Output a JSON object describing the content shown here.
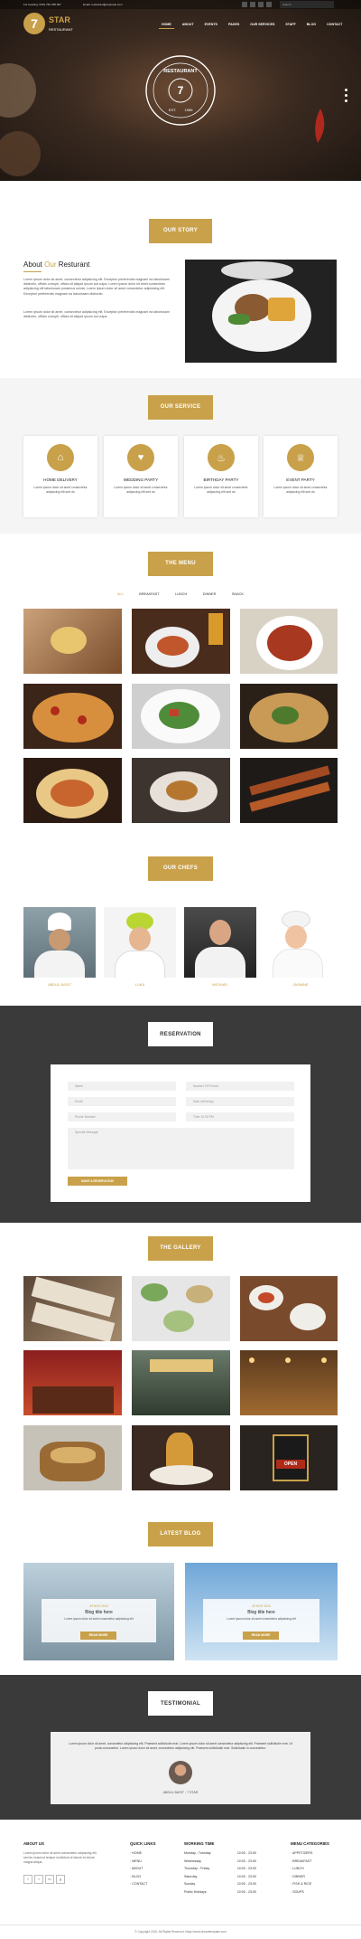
{
  "topbar": {
    "contact": "For booking: 0301 765 788 007",
    "email": "Email: restaurant@example.com"
  },
  "brand": {
    "number": "7",
    "name": "STAR",
    "sub": "RESTAURANT"
  },
  "nav": [
    {
      "label": "HOME"
    },
    {
      "label": "ABOUT"
    },
    {
      "label": "EVENTS"
    },
    {
      "label": "PAGES"
    },
    {
      "label": "OUR SERVICES"
    },
    {
      "label": "STAFF"
    },
    {
      "label": "BLOG"
    },
    {
      "label": "CONTACT"
    }
  ],
  "hero": {
    "logo_top": "RESTAURANT",
    "logo_num": "7",
    "logo_est": "EST.",
    "logo_year": "1986"
  },
  "story": {
    "title": "OUR STORY",
    "heading_pre": "About ",
    "heading_accent": "Our",
    "heading_post": " Resturant",
    "p1": "Lorem ipsum dolor sit amet, consectetur adipisicing elit. Excepturi perferendis magnam ea laboriosam distinctio, officiis corrupti, officia sit aliquid ipsum aut culpa. Lorem ipsum dolor sit amet consectetur adipisicing elit laboriosam possimus soluta. Lorem ipsum dolor sit amet consectetur adipisicing elit. Excepturi perferendis magnam ea laboriosam distinctio.",
    "p2": "Lorem ipsum dolor sit amet, consectetur adipisicing elit. Excepturi perferendis magnam ea laboriosam distinctio, officiis corrupti, officia sit aliquid ipsum aut culpa."
  },
  "service": {
    "title": "OUR SERVICE",
    "cards": [
      {
        "icon": "home-icon",
        "glyph": "⌂",
        "title": "HOME DELIVERY",
        "desc": "Lorem ipsum dolor sit amet consectetur adipiscing elit sed do"
      },
      {
        "icon": "heart-icon",
        "glyph": "♥",
        "title": "WEDDING PARTY",
        "desc": "Lorem ipsum dolor sit amet consectetur adipiscing elit sed do"
      },
      {
        "icon": "cake-icon",
        "glyph": "♨",
        "title": "BIRTHDAY PARTY",
        "desc": "Lorem ipsum dolor sit amet consectetur adipiscing elit sed do"
      },
      {
        "icon": "cup-icon",
        "glyph": "♕",
        "title": "EVENT PARTY",
        "desc": "Lorem ipsum dolor sit amet consectetur adipiscing elit sed do"
      }
    ]
  },
  "menu": {
    "title": "THE MENU",
    "filters": [
      "ALL",
      "BREAKFAST",
      "LUNCH",
      "DINNER",
      "SNACK"
    ]
  },
  "chefs": {
    "title": "OUR CHEFS",
    "names": [
      "ABDUL BASIT",
      "LUKA",
      "MICHAEL",
      "JASMINE"
    ]
  },
  "reservation": {
    "title": "RESERVATION",
    "fields": {
      "name": "Name",
      "number": "Number Of Person",
      "email": "Email",
      "date": "Date dd/mm/yy",
      "phone": "Phone Number",
      "time": "Time 10:00 PM",
      "message": "Special Message"
    },
    "button": "MAKE A RESERVATION"
  },
  "gallery": {
    "title": "THE GALLERY"
  },
  "blog": {
    "title": "LATEST BLOG",
    "posts": [
      {
        "date": "29 NOV 2016",
        "title": "Blog title here",
        "desc": "Lorem ipsum dolor sit amet consectetur adipisicing elit",
        "btn": "READ MORE"
      },
      {
        "date": "29 NOV 2016",
        "title": "Blog title here",
        "desc": "Lorem ipsum dolor sit amet consectetur adipisicing elit",
        "btn": "READ MORE"
      }
    ]
  },
  "testimonial": {
    "title": "TESTIMONIAL",
    "quote": "Lorem ipsum dolor sit amet, consectetur adipisicing elit. Praesent sollicitudin erat. Lorem ipsum dolor sit amet consectetur adipiscing elit. Praesent sollicitudin erat. Ut porta consectetur. Lorem ipsum dolor sit amet, consectetur adipisicing elit. Praesent sollicitudin erat. Sollicitudin in consectetur.",
    "author": "ABDUL BASIT - 7 STAR"
  },
  "footer": {
    "about_title": "ABOUT US",
    "about_text": "Lorem ipsum dolor sit amet consectetur adipiscing elit sed do eiusmod tempor incididunt ut labore et dolore magna aliqua.",
    "links_title": "QUICK LINKS",
    "links": [
      "HOME",
      "MENU",
      "ABOUT",
      "BLOG",
      "CONTACT"
    ],
    "hours_title": "WORKING TIME",
    "hours": [
      {
        "d": "Monday - Tuesday",
        "t": "10:00 - 23:00"
      },
      {
        "d": "Wednesday",
        "t": "10:00 - 23:00"
      },
      {
        "d": "Thursday - Friday",
        "t": "10:00 - 23:00"
      },
      {
        "d": "Saturday",
        "t": "10:00 - 23:00"
      },
      {
        "d": "Sunday",
        "t": "10:00 - 23:00"
      },
      {
        "d": "Public Holidays",
        "t": "10:00 - 23:00"
      }
    ],
    "cat_title": "MENU CATEGORIES",
    "cats": [
      "APPETIZERS",
      "BREAKFAST",
      "LUNCH",
      "DINNER",
      "FISH & RICE",
      "SOUPS"
    ],
    "copyright": "© Copyright 2016. All Rights Reserved. https://www.dreamtemplate.com"
  },
  "colors": {
    "accent": "#c9a14a",
    "dark": "#333333"
  }
}
